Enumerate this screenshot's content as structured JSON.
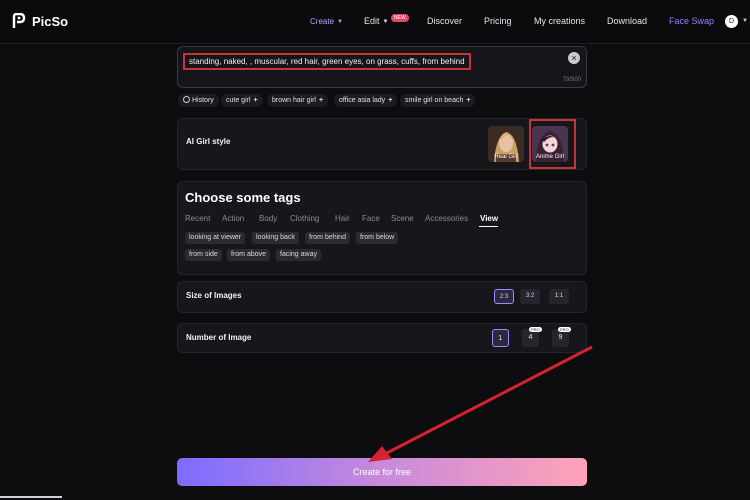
{
  "header": {
    "brand": "PicSo",
    "nav": {
      "create": "Create",
      "edit": "Edit",
      "edit_badge": "NEW",
      "discover": "Discover",
      "pricing": "Pricing",
      "my_creations": "My creations",
      "download": "Download",
      "face_swap": "Face Swap"
    },
    "avatar_initial": "D",
    "accent_color": "#8c86ff"
  },
  "prompt": {
    "value": "standing, naked, , muscular, red hair, green eyes, on grass, cuffs, from behind",
    "counter": "79/500"
  },
  "suggestions": {
    "history": "History",
    "items": [
      "cute girl",
      "brown hair girl",
      "office asia lady",
      "smile girl on beach"
    ]
  },
  "style": {
    "label": "AI Girl style",
    "options": [
      {
        "label": "Real Girl",
        "selected": false
      },
      {
        "label": "Anime Girl",
        "selected": true
      }
    ]
  },
  "tags": {
    "title": "Choose some tags",
    "tabs": [
      "Recent",
      "Action",
      "Body",
      "Clothing",
      "Hair",
      "Face",
      "Scene",
      "Accessories",
      "View"
    ],
    "active_tab": "View",
    "chips": [
      "looking at viewer",
      "looking back",
      "from behind",
      "from below",
      "from side",
      "from above",
      "facing away"
    ]
  },
  "size": {
    "label": "Size of Images",
    "options": [
      "2:3",
      "3:2",
      "1:1"
    ],
    "selected": "2:3"
  },
  "number": {
    "label": "Number of Image",
    "options": [
      "1",
      "4",
      "9"
    ],
    "selected": "1",
    "pro_badge": "PRO"
  },
  "create_button": "Create for free",
  "icons": {
    "logo": "picso-logo-icon",
    "clear": "close-icon",
    "history": "clock-icon",
    "add": "plus-icon",
    "annotation": "red-arrow"
  },
  "colors": {
    "annotation": "#c8333a",
    "gradient_start": "#7b6cff",
    "gradient_end": "#ffa3b8"
  }
}
